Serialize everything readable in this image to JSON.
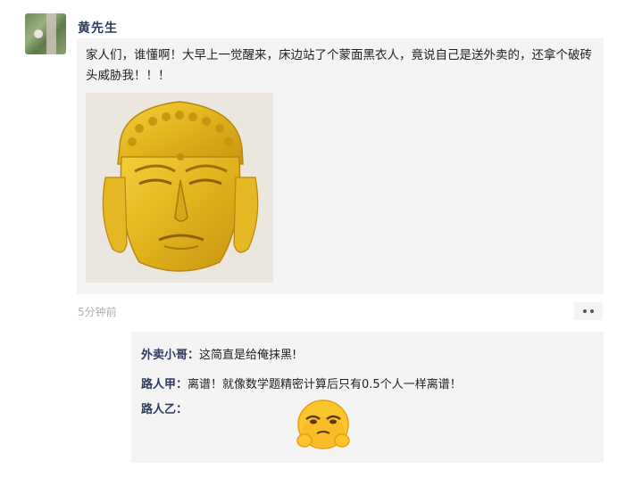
{
  "post": {
    "author": "黄先生",
    "text": "家人们，谁懂啊！大早上一觉醒来，床边站了个蒙面黑衣人，竟说自己是送外卖的，还拿个破砖头威胁我！！！",
    "time": "5分钟前",
    "image_icon": "golden-buddha-head"
  },
  "comments": [
    {
      "author": "外卖小哥：",
      "text": "这简直是给俺抹黑!"
    },
    {
      "author": "路人甲：",
      "text": "离谱！就像数学题精密计算后只有0.5个人一样离谱！"
    },
    {
      "author": "路人乙：",
      "text": "",
      "emoji": "worried-face-emoji"
    }
  ],
  "colors": {
    "author_name": "#2d3a5e",
    "card_bg": "#f4f4f4",
    "time_text": "#b0b0b0",
    "gold": "#e0b21c"
  }
}
